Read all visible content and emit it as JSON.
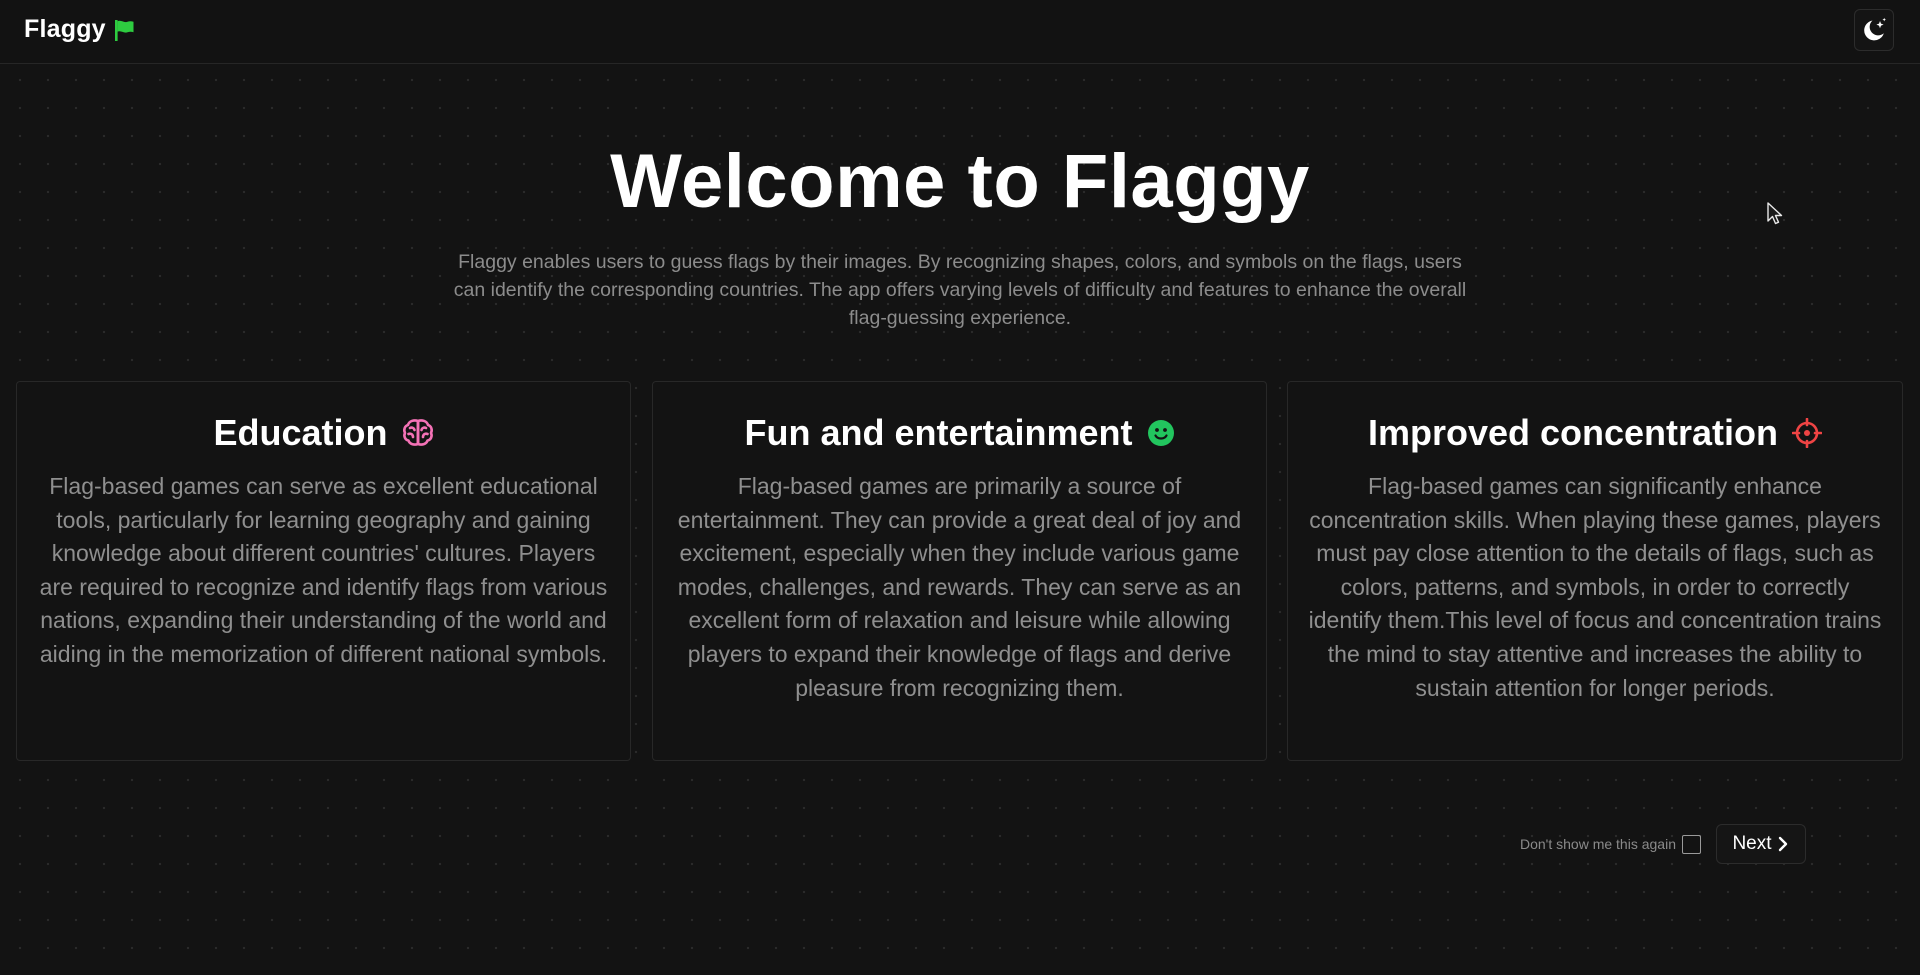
{
  "header": {
    "brand_name": "Flaggy",
    "brand_icon": "flag-icon",
    "theme_toggle_icon": "moon-stars-icon",
    "accent_color": "#2ecc40"
  },
  "hero": {
    "title": "Welcome to Flaggy",
    "description": "Flaggy enables users to guess flags by their images. By recognizing shapes, colors, and symbols on the flags, users can identify the corresponding countries. The app offers varying levels of difficulty and features to enhance the overall flag-guessing experience."
  },
  "cards": [
    {
      "title": "Education",
      "icon": "brain-icon",
      "icon_color": "#f472b6",
      "body": "Flag-based games can serve as excellent educational tools, particularly for learning geography and gaining knowledge about different countries' cultures. Players are required to recognize and identify flags from various nations, expanding their understanding of the world and aiding in the memorization of different national symbols."
    },
    {
      "title": "Fun and entertainment",
      "icon": "smile-icon",
      "icon_color": "#22c55e",
      "body": "Flag-based games are primarily a source of entertainment. They can provide a great deal of joy and excitement, especially when they include various game modes, challenges, and rewards. They can serve as an excellent form of relaxation and leisure while allowing players to expand their knowledge of flags and derive pleasure from recognizing them."
    },
    {
      "title": "Improved concentration",
      "icon": "crosshair-icon",
      "icon_color": "#ef4444",
      "body": "Flag-based games can significantly enhance concentration skills. When playing these games, players must pay close attention to the details of flags, such as colors, patterns, and symbols, in order to correctly identify them.This level of focus and concentration trains the mind to stay attentive and increases the ability to sustain attention for longer periods."
    }
  ],
  "footer": {
    "dont_show_label": "Don't show me this again",
    "dont_show_checked": false,
    "next_label": "Next",
    "next_icon": "chevron-right-icon"
  }
}
